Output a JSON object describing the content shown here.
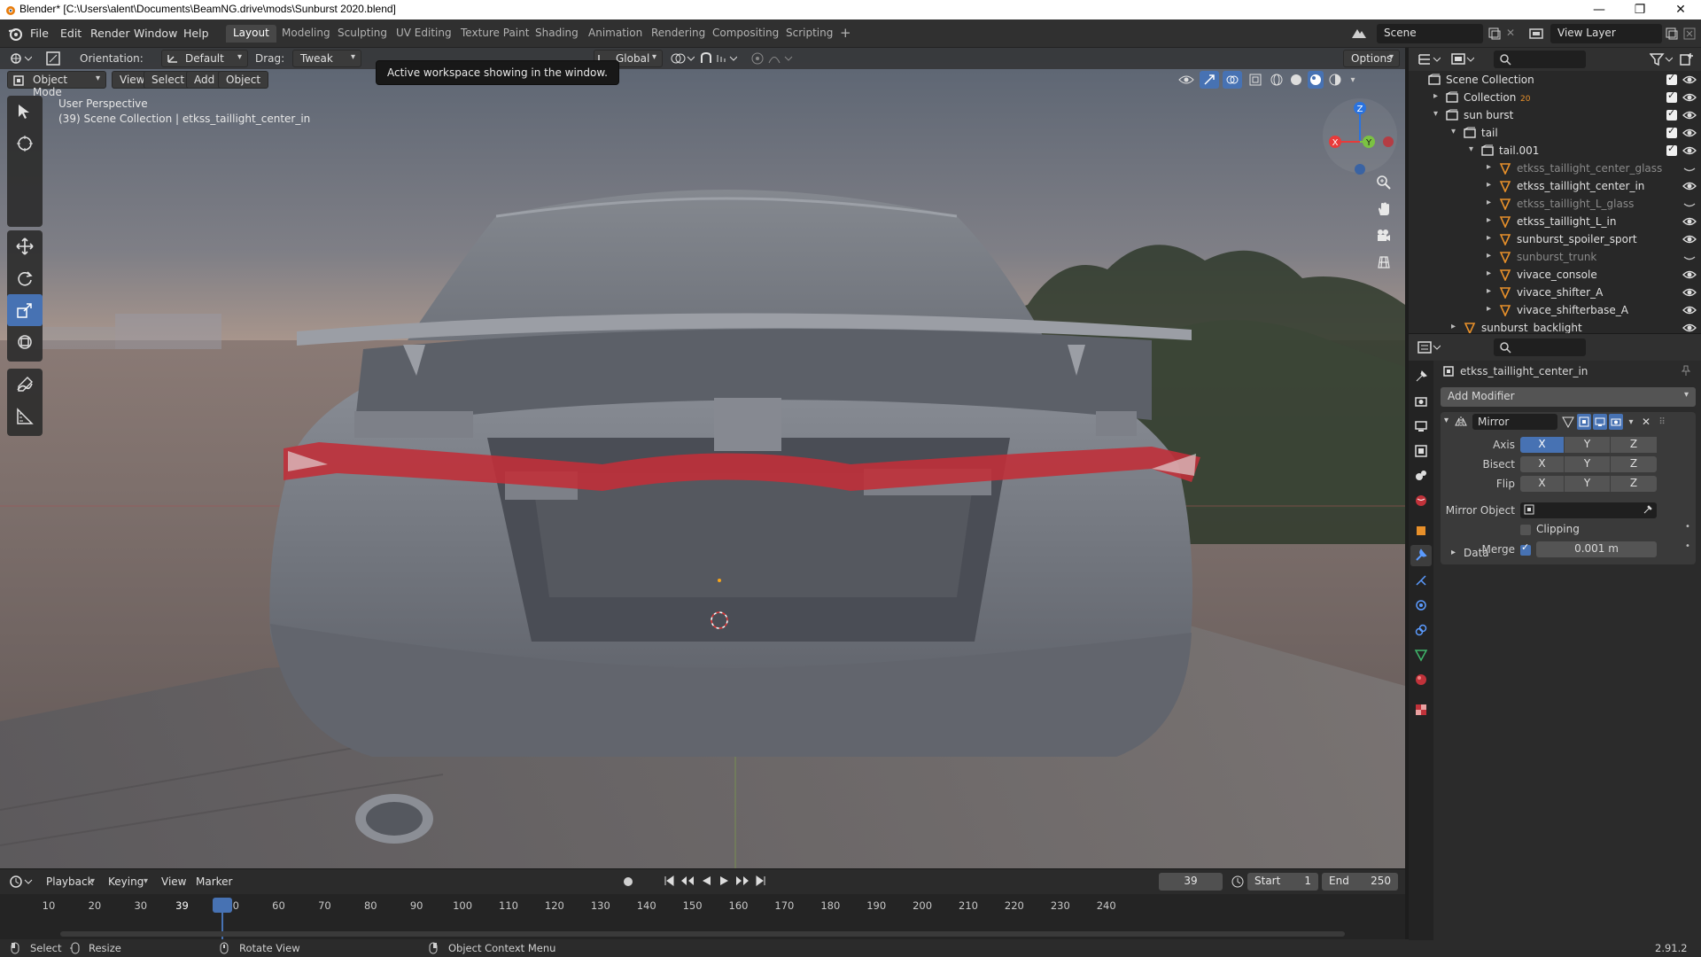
{
  "window": {
    "title": "Blender* [C:\\Users\\alent\\Documents\\BeamNG.drive\\mods\\Sunburst 2020.blend]",
    "minimize": "—",
    "maximize": "❐",
    "close": "✕"
  },
  "menubar": {
    "items": [
      "File",
      "Edit",
      "Render",
      "Window",
      "Help"
    ],
    "workspaces": [
      "Layout",
      "Modeling",
      "Sculpting",
      "UV Editing",
      "Texture Paint",
      "Shading",
      "Animation",
      "Rendering",
      "Compositing",
      "Scripting"
    ],
    "active_workspace": "Layout",
    "add_tab": "+",
    "scene": "Scene",
    "view_layer": "View Layer"
  },
  "viewport_header": {
    "orientation_label": "Orientation:",
    "orientation_value": "Default",
    "drag_label": "Drag:",
    "drag_value": "Tweak",
    "transform": "Global",
    "options": "Options",
    "mode": "Object Mode",
    "menus": [
      "View",
      "Select",
      "Add",
      "Object"
    ]
  },
  "tooltip": "Active workspace showing in the window.",
  "viewport": {
    "perspective": "User Perspective",
    "info": "(39) Scene Collection | etkss_taillight_center_in",
    "gizmo": {
      "x": "X",
      "y": "Y",
      "z": "Z"
    }
  },
  "outliner": {
    "search_placeholder": "",
    "rows": [
      {
        "label": "Scene Collection",
        "indent": 0,
        "icon": "collection",
        "dim": false
      },
      {
        "label": "Collection",
        "indent": 1,
        "icon": "collection",
        "dim": false,
        "extra": "20"
      },
      {
        "label": "sun burst",
        "indent": 1,
        "icon": "collection",
        "dim": false
      },
      {
        "label": "tail",
        "indent": 2,
        "icon": "collection",
        "dim": false
      },
      {
        "label": "tail.001",
        "indent": 3,
        "icon": "collection",
        "dim": false
      },
      {
        "label": "etkss_taillight_center_glass",
        "indent": 4,
        "icon": "mesh",
        "dim": true
      },
      {
        "label": "etkss_taillight_center_in",
        "indent": 4,
        "icon": "mesh",
        "dim": false
      },
      {
        "label": "etkss_taillight_L_glass",
        "indent": 4,
        "icon": "mesh",
        "dim": true
      },
      {
        "label": "etkss_taillight_L_in",
        "indent": 4,
        "icon": "mesh",
        "dim": false
      },
      {
        "label": "sunburst_spoiler_sport",
        "indent": 4,
        "icon": "mesh",
        "dim": false
      },
      {
        "label": "sunburst_trunk",
        "indent": 4,
        "icon": "mesh",
        "dim": true
      },
      {
        "label": "vivace_console",
        "indent": 4,
        "icon": "mesh",
        "dim": false
      },
      {
        "label": "vivace_shifter_A",
        "indent": 4,
        "icon": "mesh",
        "dim": false
      },
      {
        "label": "vivace_shifterbase_A",
        "indent": 4,
        "icon": "mesh",
        "dim": false
      },
      {
        "label": "sunburst_backlight",
        "indent": 2,
        "icon": "mesh",
        "dim": false
      }
    ]
  },
  "properties": {
    "object_name": "etkss_taillight_center_in",
    "add_modifier": "Add Modifier",
    "modifier_name": "Mirror",
    "axis_label": "Axis",
    "bisect_label": "Bisect",
    "flip_label": "Flip",
    "axes": [
      "X",
      "Y",
      "Z"
    ],
    "mirror_object_label": "Mirror Object",
    "clipping_label": "Clipping",
    "merge_label": "Merge",
    "merge_value": "0.001 m",
    "data_label": "Data"
  },
  "timeline": {
    "menus": [
      "Playback",
      "Keying",
      "View",
      "Marker"
    ],
    "current_frame": "39",
    "start_label": "Start",
    "start_value": "1",
    "end_label": "End",
    "end_value": "250",
    "ticks": [
      "10",
      "20",
      "30",
      "39",
      "50",
      "60",
      "70",
      "80",
      "90",
      "100",
      "110",
      "120",
      "130",
      "140",
      "150",
      "160",
      "170",
      "180",
      "190",
      "200",
      "210",
      "220",
      "230",
      "240"
    ]
  },
  "statusbar": {
    "select": "Select",
    "resize": "Resize",
    "rotate": "Rotate View",
    "context": "Object Context Menu",
    "version": "2.91.2"
  },
  "colors": {
    "accent": "#4772b3",
    "bg_dark": "#1d1d1d",
    "panel": "#2b2b2b",
    "taillight_red": "#c0303a"
  }
}
